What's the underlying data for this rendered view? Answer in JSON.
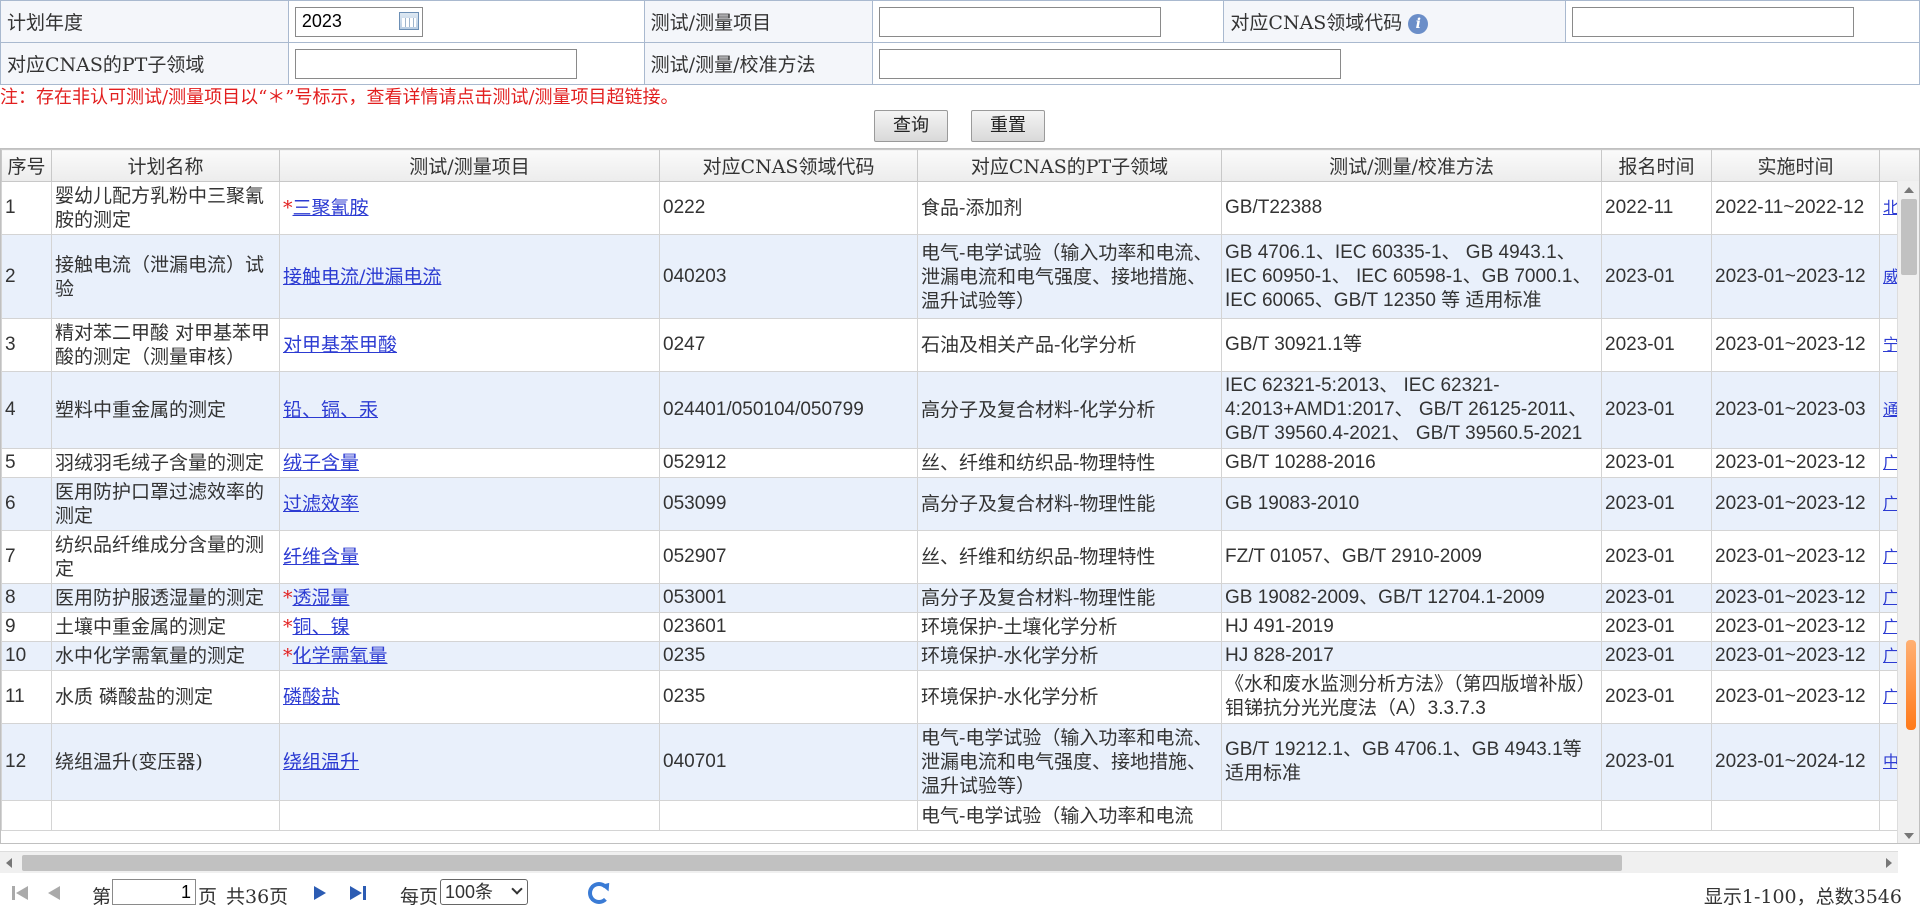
{
  "form": {
    "year_label": "计划年度",
    "year_value": "2023",
    "project_label": "测试/测量项目",
    "project_value": "",
    "cnas_code_label": "对应CNAS领域代码",
    "cnas_code_value": "",
    "pt_label": "对应CNAS的PT子领域",
    "pt_value": "",
    "method_label": "测试/测量/校准方法",
    "method_value": ""
  },
  "note": "注：存在非认可测试/测量项目以“＊”号标示，查看详情请点击测试/测量项目超链接。",
  "buttons": {
    "query": "查询",
    "reset": "重置"
  },
  "table": {
    "headers": [
      "序号",
      "计划名称",
      "测试/测量项目",
      "对应CNAS领域代码",
      "对应CNAS的PT子领域",
      "测试/测量/校准方法",
      "报名时间",
      "实施时间",
      ""
    ],
    "rows": [
      {
        "no": "1",
        "name": "婴幼儿配方乳粉中三聚氰胺的测定",
        "star": "*",
        "item": "三聚氰胺",
        "code": "0222",
        "pt": "食品-添加剂",
        "method": "GB/T22388",
        "reg": "2022-11",
        "impl": "2022-11~2022-12",
        "extra": "北研"
      },
      {
        "no": "2",
        "name": "接触电流（泄漏电流）试验",
        "star": "",
        "item": "接触电流/泄漏电流",
        "code": "040203",
        "pt": "电气-电学试验（输入功率和电流、泄漏电流和电气强度、接地措施、温升试验等）",
        "method": "GB 4706.1、IEC 60335-1、 GB 4943.1、IEC 60950-1、 IEC 60598-1、GB 7000.1、 IEC 60065、GB/T 12350 等 适用标准",
        "reg": "2023-01",
        "impl": "2023-01~2023-12",
        "extra": "威"
      },
      {
        "no": "3",
        "name": "精对苯二甲酸 对甲基苯甲酸的测定（测量审核）",
        "star": "",
        "item": "对甲基苯甲酸",
        "code": "0247",
        "pt": "石油及相关产品-化学分析",
        "method": "GB/T 30921.1等",
        "reg": "2023-01",
        "impl": "2023-01~2023-12",
        "extra": "宁"
      },
      {
        "no": "4",
        "name": "塑料中重金属的测定",
        "star": "",
        "item": "铅、镉、汞",
        "code": "024401/050104/050799",
        "pt": "高分子及复合材料-化学分析",
        "method": "IEC 62321-5:2013、 IEC 62321-4:2013+AMD1:2017、 GB/T 26125-2011、 GB/T 39560.4-2021、 GB/T 39560.5-2021",
        "reg": "2023-01",
        "impl": "2023-01~2023-03",
        "extra": "通公"
      },
      {
        "no": "5",
        "name": "羽绒羽毛绒子含量的测定",
        "star": "",
        "item": "绒子含量",
        "code": "052912",
        "pt": "丝、纤维和纺织品-物理特性",
        "method": "GB/T 10288-2016",
        "reg": "2023-01",
        "impl": "2023-01~2023-12",
        "extra": "广"
      },
      {
        "no": "6",
        "name": "医用防护口罩过滤效率的测定",
        "star": "",
        "item": "过滤效率",
        "code": "053099",
        "pt": "高分子及复合材料-物理性能",
        "method": "GB 19083-2010",
        "reg": "2023-01",
        "impl": "2023-01~2023-12",
        "extra": "广"
      },
      {
        "no": "7",
        "name": "纺织品纤维成分含量的测定",
        "star": "",
        "item": "纤维含量",
        "code": "052907",
        "pt": "丝、纤维和纺织品-物理特性",
        "method": "FZ/T 01057、GB/T 2910-2009",
        "reg": "2023-01",
        "impl": "2023-01~2023-12",
        "extra": "广"
      },
      {
        "no": "8",
        "name": "医用防护服透湿量的测定",
        "star": "*",
        "item": "透湿量",
        "code": "053001",
        "pt": "高分子及复合材料-物理性能",
        "method": "GB 19082-2009、GB/T 12704.1-2009",
        "reg": "2023-01",
        "impl": "2023-01~2023-12",
        "extra": "广"
      },
      {
        "no": "9",
        "name": "土壤中重金属的测定",
        "star": "*",
        "item": "铜、镍",
        "code": "023601",
        "pt": "环境保护-土壤化学分析",
        "method": "HJ 491-2019",
        "reg": "2023-01",
        "impl": "2023-01~2023-12",
        "extra": "广"
      },
      {
        "no": "10",
        "name": "水中化学需氧量的测定",
        "star": "*",
        "item": "化学需氧量",
        "code": "0235",
        "pt": "环境保护-水化学分析",
        "method": "HJ 828-2017",
        "reg": "2023-01",
        "impl": "2023-01~2023-12",
        "extra": "广"
      },
      {
        "no": "11",
        "name": "水质 磷酸盐的测定",
        "star": "",
        "item": "磷酸盐",
        "code": "0235",
        "pt": "环境保护-水化学分析",
        "method": "《水和废水监测分析方法》（第四版增补版）钼锑抗分光光度法（A）3.3.7.3",
        "reg": "2023-01",
        "impl": "2023-01~2023-12",
        "extra": "广"
      },
      {
        "no": "12",
        "name": "绕组温升(变压器)",
        "star": "",
        "item": "绕组温升",
        "code": "040701",
        "pt": "电气-电学试验（输入功率和电流、泄漏电流和电气强度、接地措施、温升试验等）",
        "method": "GB/T 19212.1、GB 4706.1、GB 4943.1等适用标准",
        "reg": "2023-01",
        "impl": "2023-01~2024-12",
        "extra": "中"
      },
      {
        "no": "",
        "name": "",
        "star": "",
        "item": "",
        "code": "",
        "pt": "电气-电学试验（输入功率和电流",
        "method": "",
        "reg": "",
        "impl": "",
        "extra": ""
      }
    ]
  },
  "pager": {
    "page_prefix": "第",
    "page_value": "1",
    "page_suffix": "页",
    "total_pages": "共36页",
    "per_page_label": "每页",
    "per_page_value": "100条",
    "display_info": "显示1-100，总数3546"
  },
  "colors": {
    "note_red": "#e21e1e",
    "link_blue": "#2c3bd2",
    "alt_row": "#e9f0fb"
  }
}
